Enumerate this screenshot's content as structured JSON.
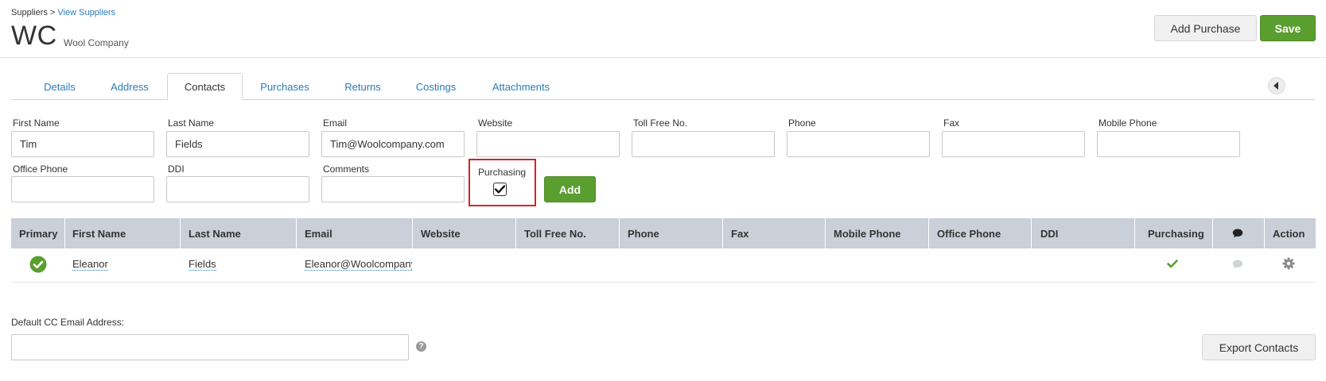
{
  "header": {
    "breadcrumb_root": "Suppliers",
    "breadcrumb_sep": ">",
    "breadcrumb_link": "View Suppliers",
    "supplier_code": "WC",
    "supplier_name": "Wool Company",
    "add_purchase_label": "Add Purchase",
    "save_label": "Save"
  },
  "tabs": [
    {
      "label": "Details"
    },
    {
      "label": "Address"
    },
    {
      "label": "Contacts",
      "active": true
    },
    {
      "label": "Purchases"
    },
    {
      "label": "Returns"
    },
    {
      "label": "Costings"
    },
    {
      "label": "Attachments"
    }
  ],
  "form": {
    "first_name": {
      "label": "First Name",
      "value": "Tim"
    },
    "last_name": {
      "label": "Last Name",
      "value": "Fields"
    },
    "email": {
      "label": "Email",
      "value": "Tim@Woolcompany.com"
    },
    "website": {
      "label": "Website",
      "value": ""
    },
    "toll_free": {
      "label": "Toll Free No.",
      "value": ""
    },
    "phone": {
      "label": "Phone",
      "value": ""
    },
    "fax": {
      "label": "Fax",
      "value": ""
    },
    "mobile": {
      "label": "Mobile Phone",
      "value": ""
    },
    "office_phone": {
      "label": "Office Phone",
      "value": ""
    },
    "ddi": {
      "label": "DDI",
      "value": ""
    },
    "comments": {
      "label": "Comments",
      "value": ""
    },
    "purchasing": {
      "label": "Purchasing",
      "checked": true
    },
    "add_label": "Add"
  },
  "table": {
    "headers": [
      "Primary",
      "First Name",
      "Last Name",
      "Email",
      "Website",
      "Toll Free No.",
      "Phone",
      "Fax",
      "Mobile Phone",
      "Office Phone",
      "DDI",
      "Purchasing",
      "comment-icon",
      "Action"
    ],
    "rows": [
      {
        "primary": true,
        "first_name": "Eleanor",
        "last_name": "Fields",
        "email": "Eleanor@Woolcompany",
        "purchasing": true
      }
    ]
  },
  "footer": {
    "cc_label": "Default CC Email Address:",
    "cc_value": "",
    "export_label": "Export Contacts"
  },
  "colors": {
    "accent_green": "#5a9e2f",
    "link_blue": "#2b7bb9",
    "header_gray": "#c9d0d7",
    "highlight_red": "#d1232a"
  }
}
